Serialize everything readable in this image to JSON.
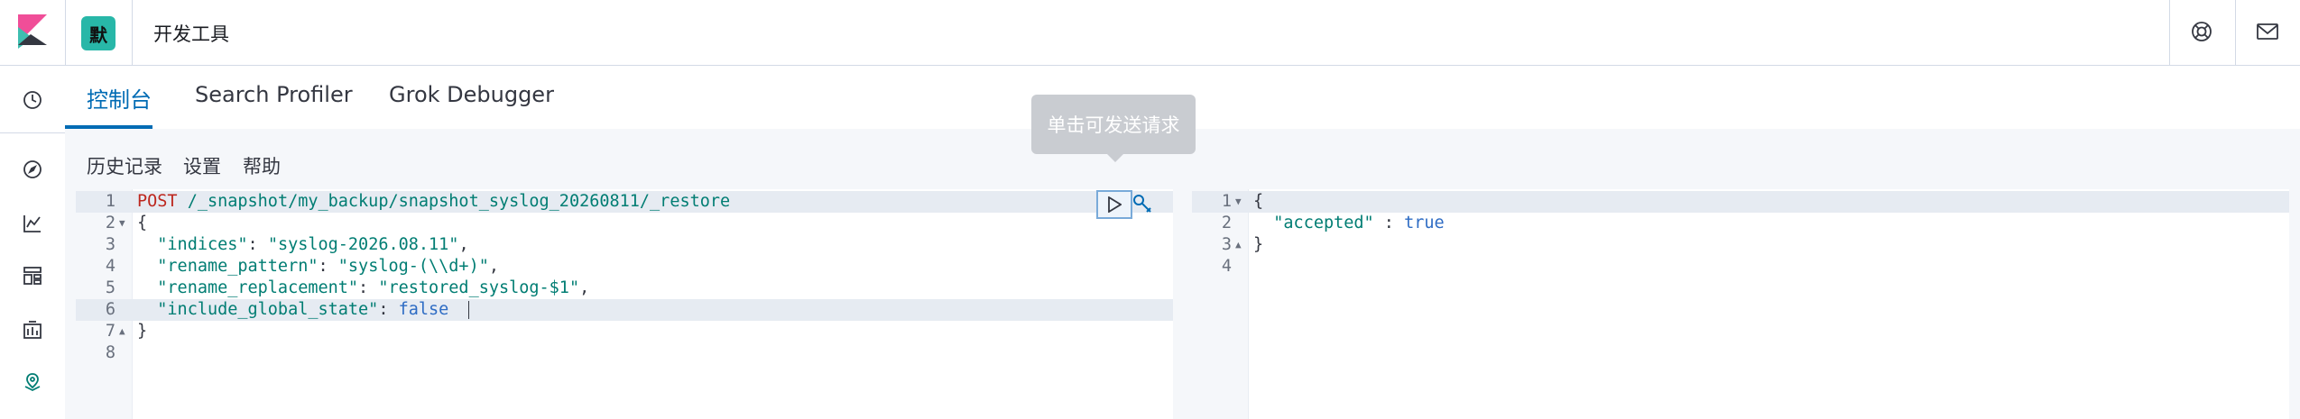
{
  "header": {
    "space_initial": "默",
    "app_title": "开发工具",
    "icons": [
      "elastic-logo-icon",
      "help-icon",
      "mail-icon"
    ]
  },
  "nav": {
    "icons": [
      "clock-icon",
      "compass-icon",
      "visualize-icon",
      "dashboard-icon",
      "canvas-icon",
      "maps-icon"
    ]
  },
  "tabs": [
    {
      "label": "控制台",
      "active": true
    },
    {
      "label": "Search Profiler",
      "active": false
    },
    {
      "label": "Grok Debugger",
      "active": false
    }
  ],
  "toolbar": {
    "history": "历史记录",
    "settings": "设置",
    "help": "帮助"
  },
  "tooltip": "单击可发送请求",
  "request_editor": {
    "lines": [
      {
        "n": "1",
        "fold": "",
        "tokens": [
          {
            "t": "POST",
            "c": "k-method"
          },
          {
            "t": " ",
            "c": "k-punc"
          },
          {
            "t": "/_snapshot/my_backup/snapshot_syslog_20260811/_restore",
            "c": "k-url"
          }
        ]
      },
      {
        "n": "2",
        "fold": "▼",
        "tokens": [
          {
            "t": "{",
            "c": "k-punc"
          }
        ]
      },
      {
        "n": "3",
        "fold": "",
        "tokens": [
          {
            "t": "  ",
            "c": "k-punc"
          },
          {
            "t": "\"indices\"",
            "c": "k-key"
          },
          {
            "t": ": ",
            "c": "k-punc"
          },
          {
            "t": "\"syslog-2026.08.11\"",
            "c": "k-str"
          },
          {
            "t": ",",
            "c": "k-punc"
          }
        ]
      },
      {
        "n": "4",
        "fold": "",
        "tokens": [
          {
            "t": "  ",
            "c": "k-punc"
          },
          {
            "t": "\"rename_pattern\"",
            "c": "k-key"
          },
          {
            "t": ": ",
            "c": "k-punc"
          },
          {
            "t": "\"syslog-(\\\\d+)\"",
            "c": "k-str"
          },
          {
            "t": ",",
            "c": "k-punc"
          }
        ]
      },
      {
        "n": "5",
        "fold": "",
        "tokens": [
          {
            "t": "  ",
            "c": "k-punc"
          },
          {
            "t": "\"rename_replacement\"",
            "c": "k-key"
          },
          {
            "t": ": ",
            "c": "k-punc"
          },
          {
            "t": "\"restored_syslog-$1\"",
            "c": "k-str"
          },
          {
            "t": ",",
            "c": "k-punc"
          }
        ]
      },
      {
        "n": "6",
        "fold": "",
        "tokens": [
          {
            "t": "  ",
            "c": "k-punc"
          },
          {
            "t": "\"include_global_state\"",
            "c": "k-key"
          },
          {
            "t": ": ",
            "c": "k-punc"
          },
          {
            "t": "false",
            "c": "k-bool"
          }
        ]
      },
      {
        "n": "7",
        "fold": "▲",
        "tokens": [
          {
            "t": "}",
            "c": "k-punc"
          }
        ]
      },
      {
        "n": "8",
        "fold": "",
        "tokens": []
      }
    ]
  },
  "response_editor": {
    "lines": [
      {
        "n": "1",
        "fold": "▼",
        "tokens": [
          {
            "t": "{",
            "c": "k-punc"
          }
        ]
      },
      {
        "n": "2",
        "fold": "",
        "tokens": [
          {
            "t": "  ",
            "c": "k-punc"
          },
          {
            "t": "\"accepted\"",
            "c": "k-key"
          },
          {
            "t": " : ",
            "c": "k-punc"
          },
          {
            "t": "true",
            "c": "k-bool"
          }
        ]
      },
      {
        "n": "3",
        "fold": "▲",
        "tokens": [
          {
            "t": "}",
            "c": "k-punc"
          }
        ]
      },
      {
        "n": "4",
        "fold": "",
        "tokens": []
      }
    ]
  },
  "colors": {
    "accent": "#006bb4",
    "badge": "#28b7a8",
    "method": "#bd271e",
    "string": "#017d73",
    "boolean": "#2e6cc4"
  }
}
